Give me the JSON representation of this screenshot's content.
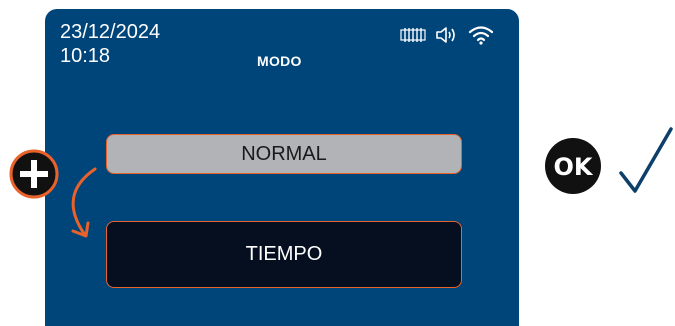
{
  "status": {
    "date": "23/12/2024",
    "time": "10:18",
    "icons": [
      "radiator-icon",
      "speaker-icon",
      "wifi-icon"
    ]
  },
  "screen": {
    "title": "MODO"
  },
  "options": [
    {
      "label": "NORMAL",
      "selected": false
    },
    {
      "label": "TIEMPO",
      "selected": true
    }
  ],
  "controls": {
    "plus_icon": "plus-icon",
    "ok_icon": "ok-icon",
    "check_icon": "checkmark-icon"
  },
  "colors": {
    "screen_bg": "#00457a",
    "accent": "#e8622a",
    "normal_bg": "#b1b3b6",
    "selected_bg": "#050f20",
    "check": "#0d3f6b"
  }
}
